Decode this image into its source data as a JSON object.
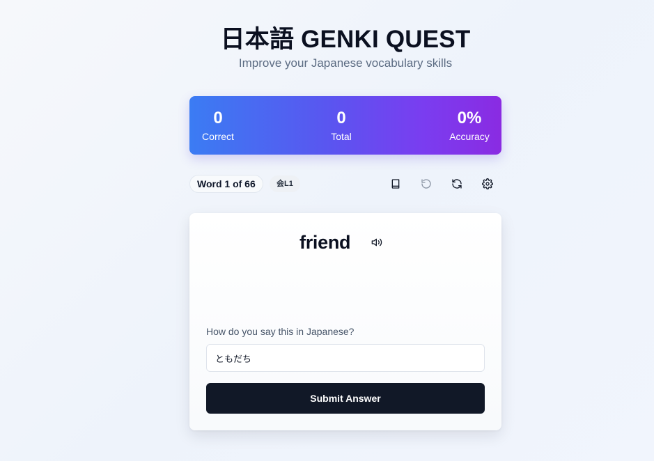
{
  "header": {
    "title": "日本語 GENKI QUEST",
    "subtitle": "Improve your Japanese vocabulary skills"
  },
  "stats": {
    "correct_value": "0",
    "correct_label": "Correct",
    "total_value": "0",
    "total_label": "Total",
    "accuracy_value": "0%",
    "accuracy_label": "Accuracy"
  },
  "toolbar": {
    "word_progress": "Word 1 of 66",
    "lesson_tag": "会L1",
    "icons": [
      "book-icon",
      "undo-icon",
      "refresh-icon",
      "gear-icon"
    ]
  },
  "card": {
    "word": "friend",
    "speaker_icon": "speaker-icon",
    "prompt": "How do you say this in Japanese?",
    "answer_value": "ともだち",
    "submit_label": "Submit Answer"
  },
  "colors": {
    "gradient_start": "#3b7cf3",
    "gradient_end": "#8a2be2",
    "button_dark": "#111827",
    "muted_text": "#5b6b82"
  }
}
